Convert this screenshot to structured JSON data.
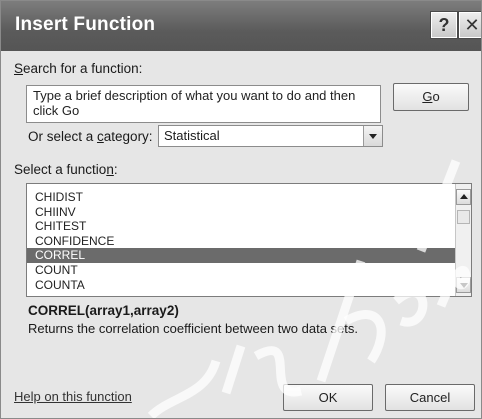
{
  "window": {
    "title": "Insert Function",
    "help_glyph": "?",
    "close_glyph": "✕"
  },
  "search": {
    "label": "Search for a function:",
    "label_access_key": "S",
    "label_rest": "earch for a function:",
    "value": "Type a brief description of what you want to do and then click Go",
    "go_button": "Go",
    "go_access_key": "G",
    "go_rest": "o"
  },
  "category": {
    "label_prefix": "Or select a ",
    "label_access_key": "c",
    "label_rest": "ategory:",
    "selected": "Statistical"
  },
  "function_list": {
    "label_prefix": "Select a functio",
    "label_access_key": "n",
    "label_suffix": ":",
    "items": [
      "CHIDIST",
      "CHIINV",
      "CHITEST",
      "CONFIDENCE",
      "CORREL",
      "COUNT",
      "COUNTA"
    ],
    "selected_index": 4
  },
  "details": {
    "signature": "CORREL(array1,array2)",
    "description": "Returns the correlation coefficient between two data sets."
  },
  "footer": {
    "help_link": "Help on this function",
    "ok_button": "OK",
    "cancel_button": "Cancel"
  },
  "colors": {
    "titlebar": "#5b5b5b",
    "dialog_bg": "#e6e6e6",
    "selection": "#6b6b6b"
  }
}
